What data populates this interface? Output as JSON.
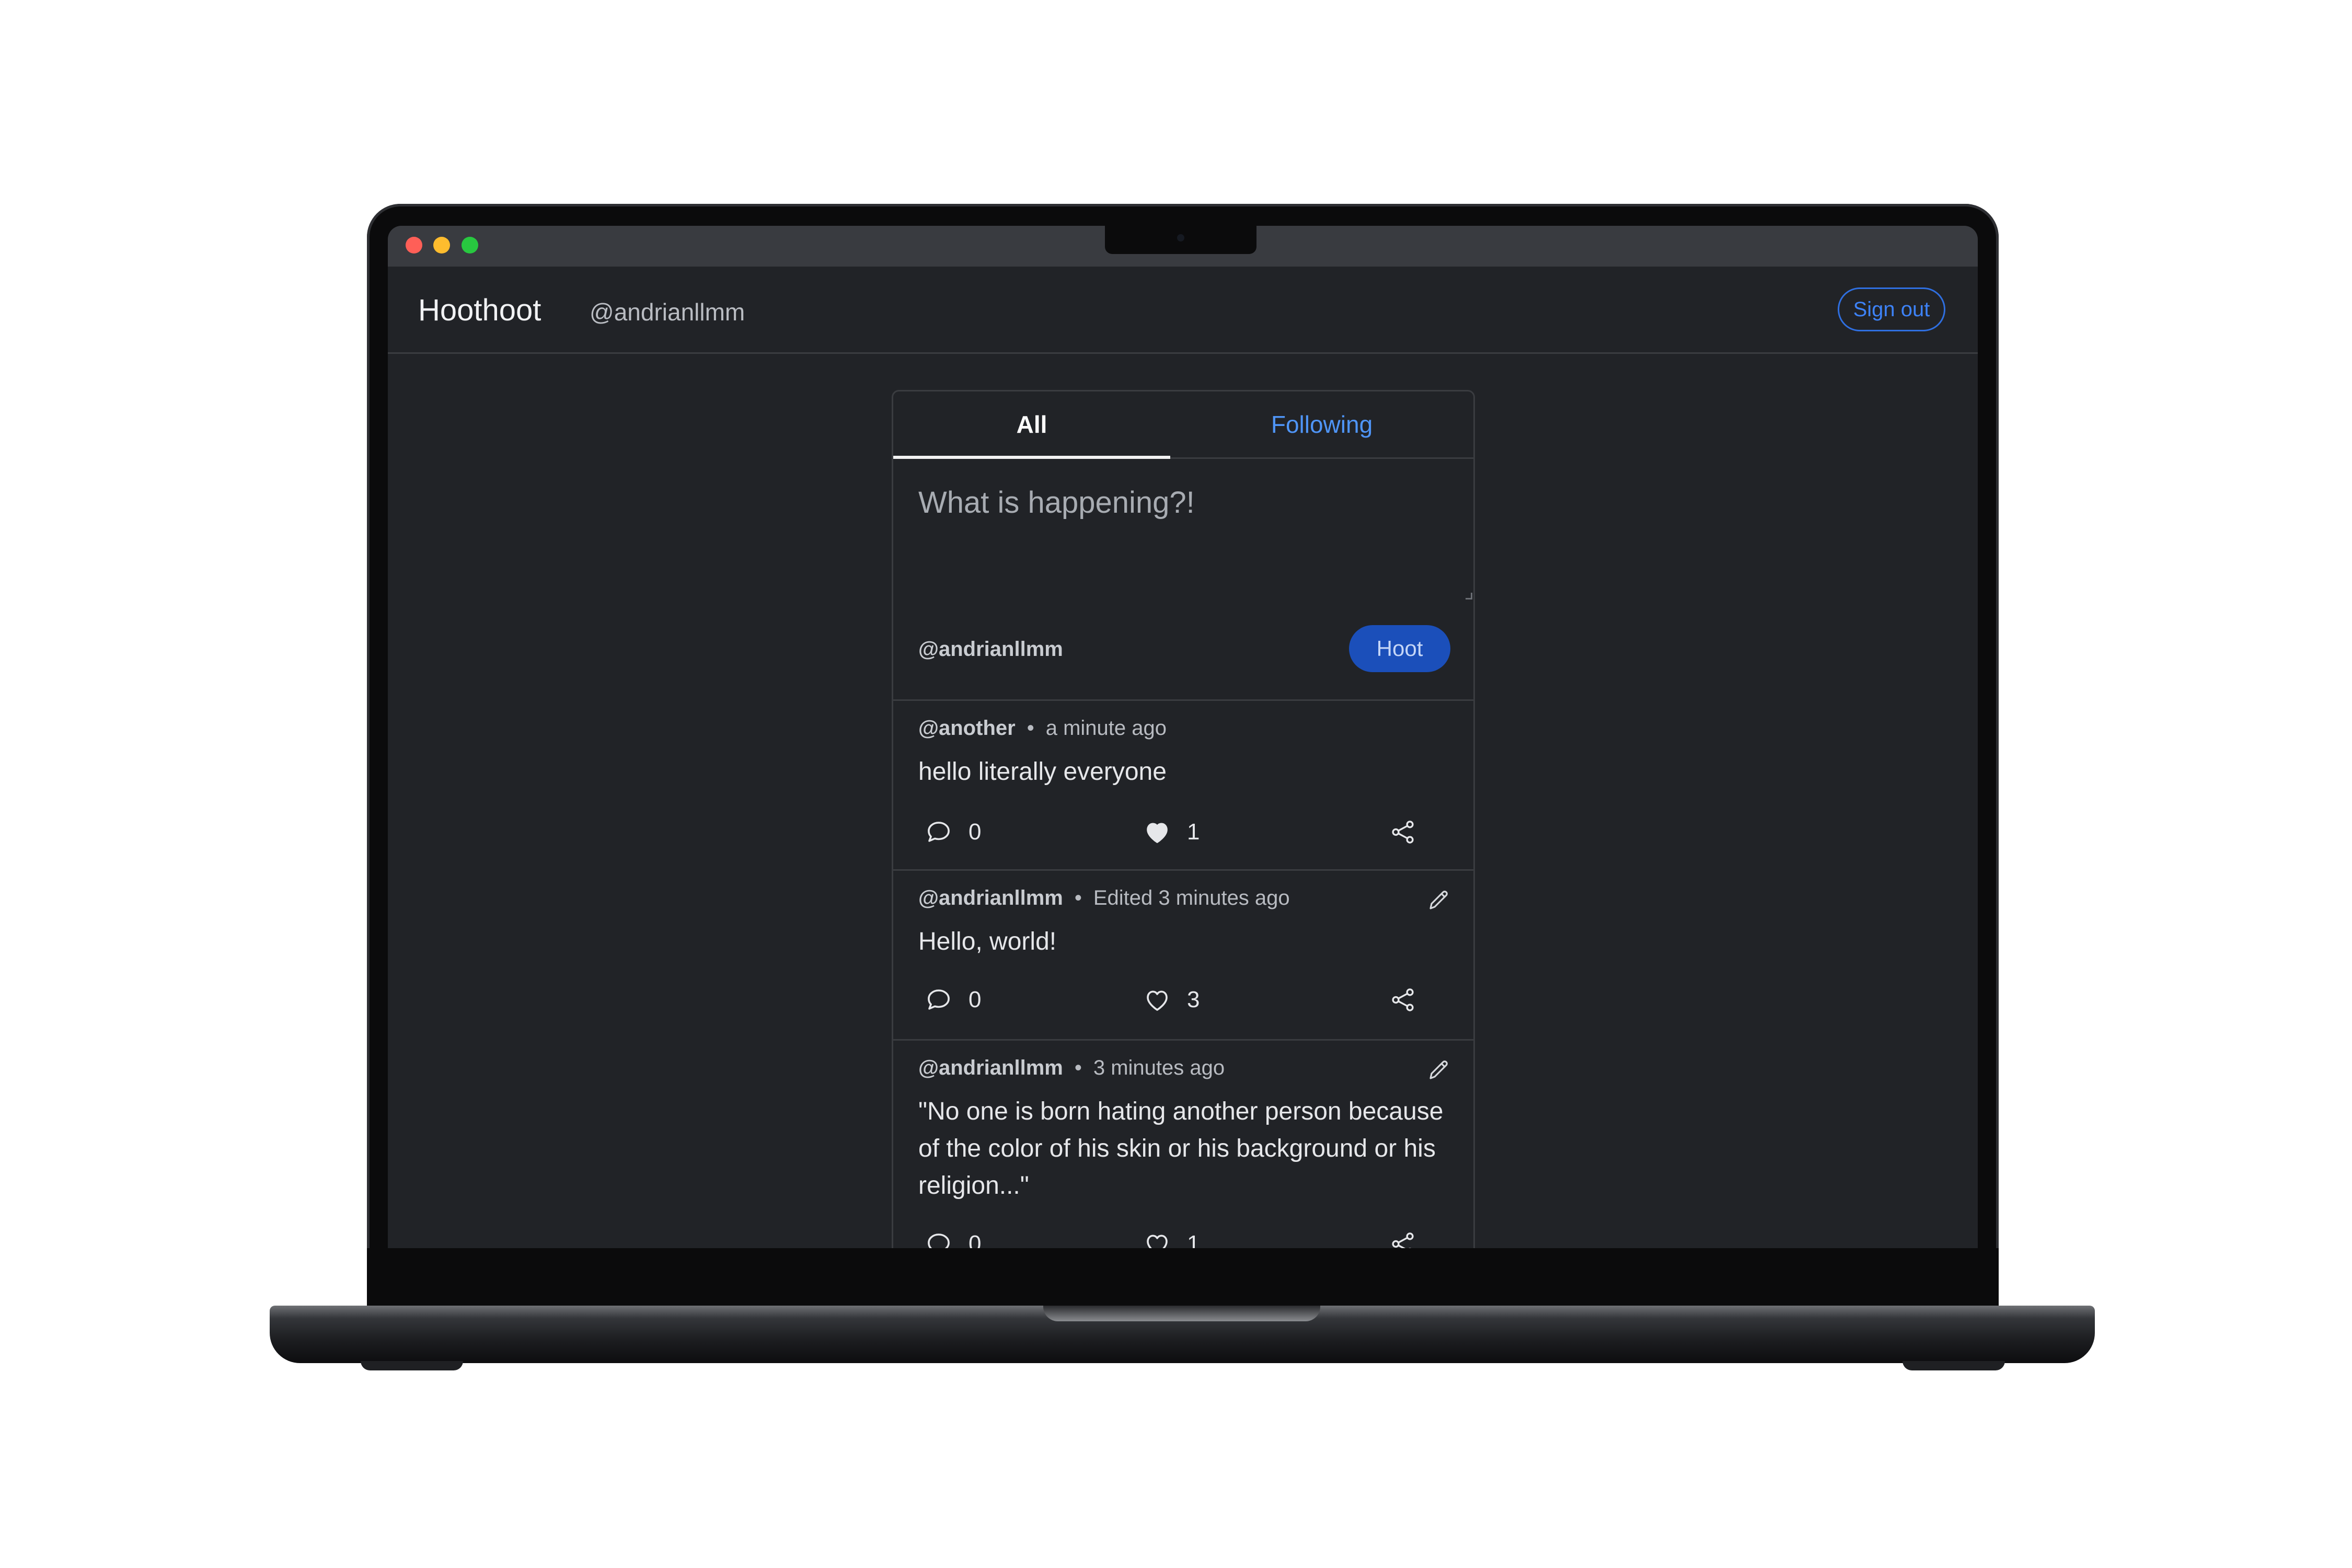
{
  "app": {
    "brand": "Hoothoot",
    "current_user": "@andrianllmm",
    "sign_out_label": "Sign out"
  },
  "tabs": [
    {
      "label": "All",
      "active": true
    },
    {
      "label": "Following",
      "active": false
    }
  ],
  "composer": {
    "placeholder": "What is happening?!",
    "author": "@andrianllmm",
    "submit_label": "Hoot"
  },
  "posts": [
    {
      "handle": "@another",
      "time": "a minute ago",
      "body": "hello literally everyone",
      "comments": "0",
      "likes": "1",
      "liked": true,
      "editable": false
    },
    {
      "handle": "@andrianllmm",
      "time": "Edited 3 minutes ago",
      "body": "Hello, world!",
      "comments": "0",
      "likes": "3",
      "liked": false,
      "editable": true
    },
    {
      "handle": "@andrianllmm",
      "time": "3 minutes ago",
      "body": "\"No one is born hating another person because of the color of his skin or his background or his religion...\"",
      "comments": "0",
      "likes": "1",
      "liked": false,
      "editable": true
    }
  ],
  "colors": {
    "background": "#212327",
    "accent": "#3d82f7",
    "hoot_button": "#1b4fba",
    "border": "#3a3c40"
  },
  "icons": {
    "window_controls": [
      "close-light",
      "minimize-light",
      "zoom-light"
    ],
    "post_actions": [
      "comment-icon",
      "heart-icon",
      "share-icon"
    ],
    "edit": "pencil-icon"
  }
}
